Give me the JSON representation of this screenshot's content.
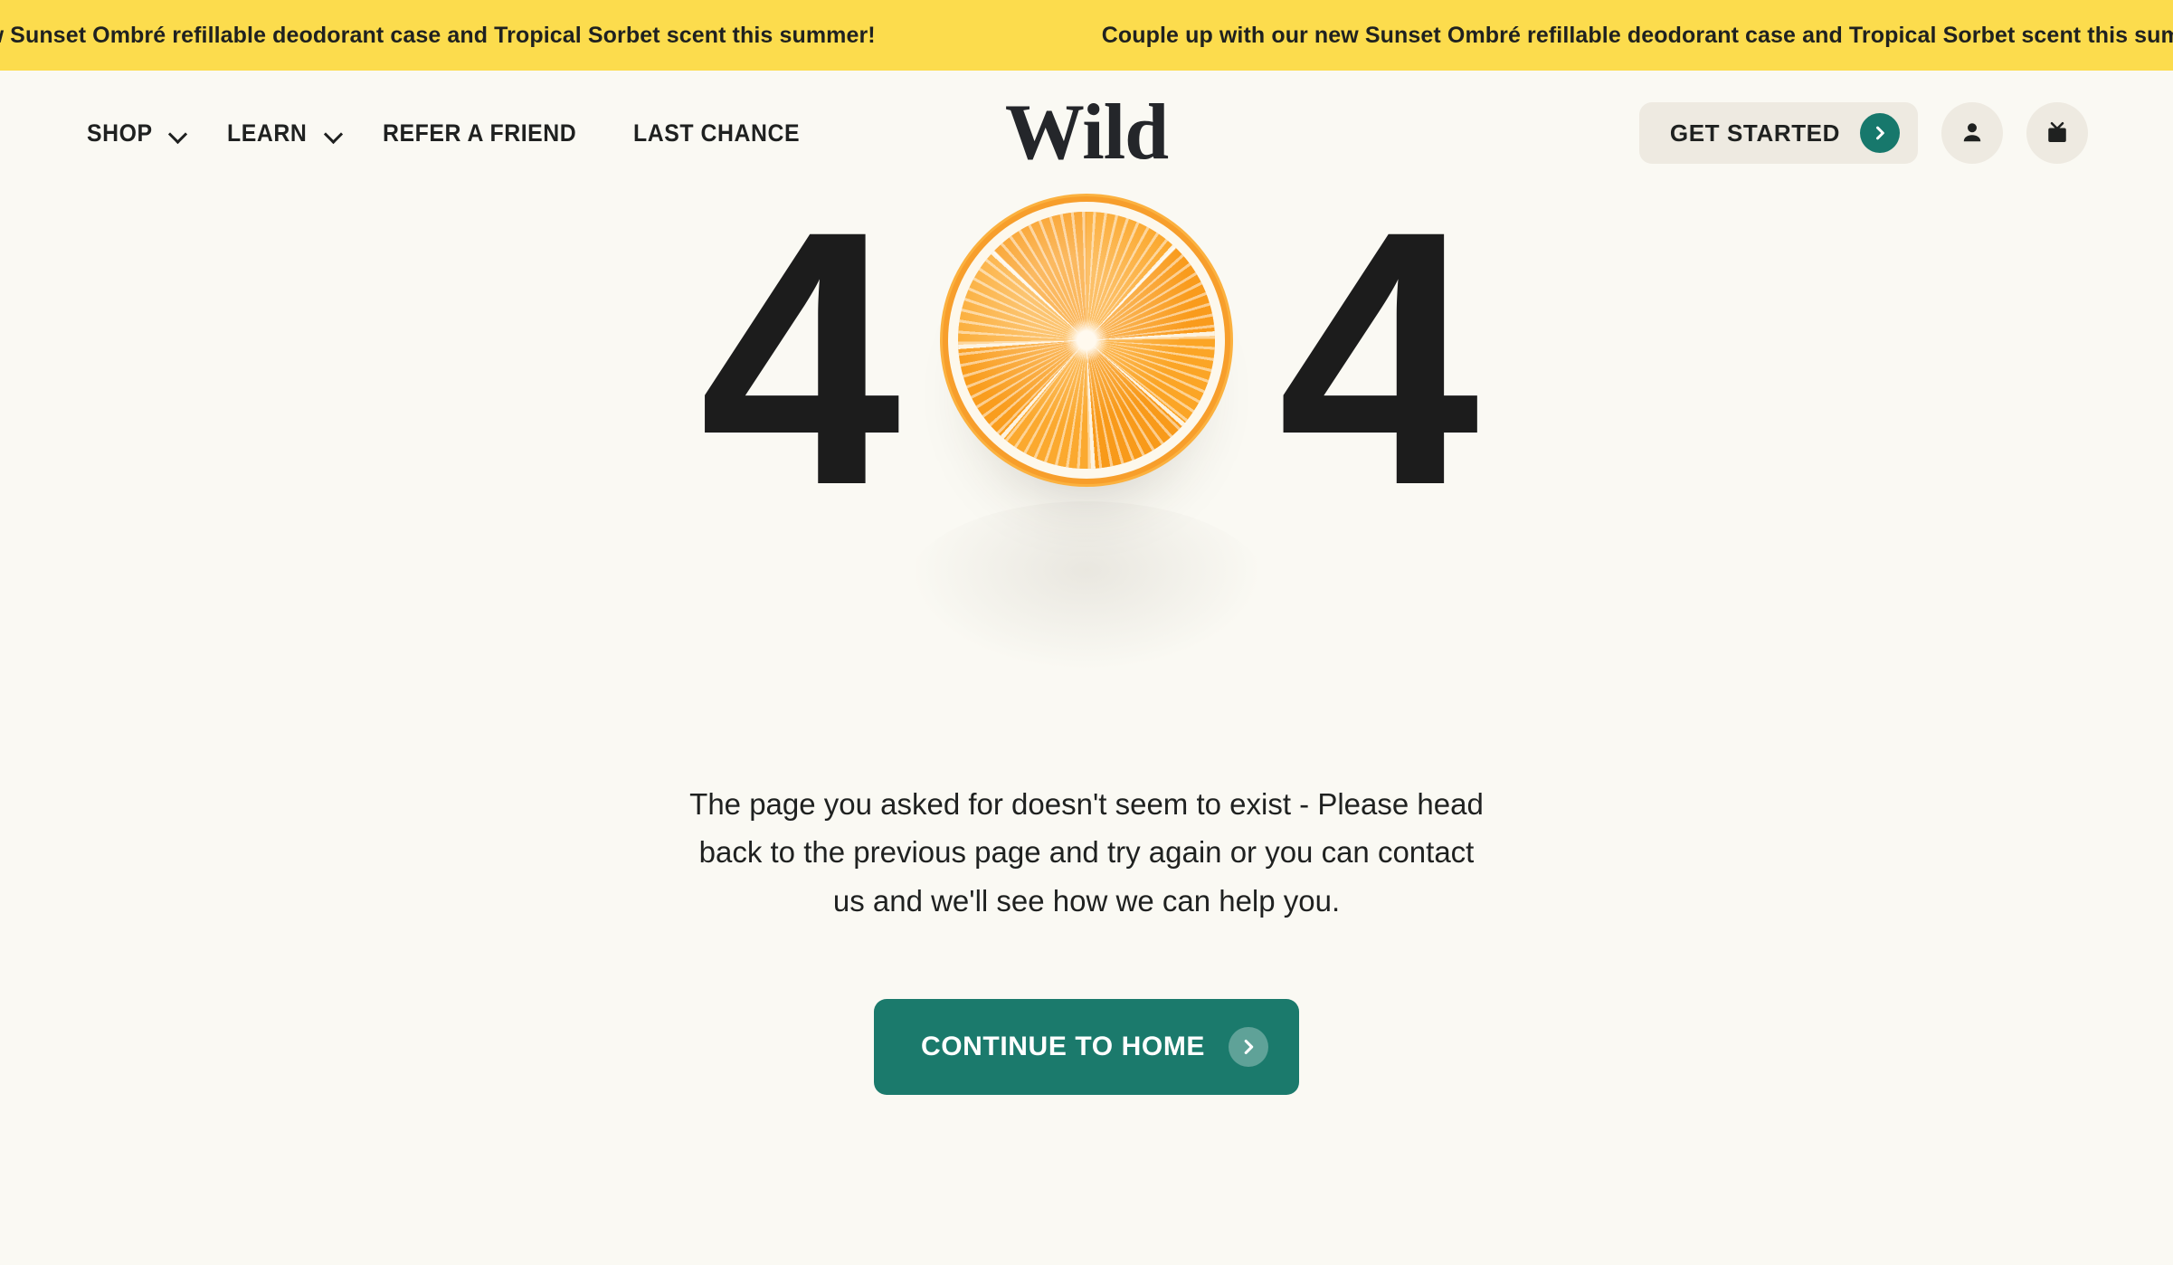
{
  "announcement": {
    "message": "Couple up with our new Sunset Ombré refillable deodorant case and Tropical Sorbet scent this summer!",
    "partial_left": "pical Sorbet scent this summer!",
    "partial_right": "C",
    "background_color": "#fcdc4d",
    "text_color": "#1f2120"
  },
  "header": {
    "logo_text": "Wild",
    "nav": [
      {
        "label": "SHOP",
        "has_dropdown": true,
        "icon": "chevron-down-icon"
      },
      {
        "label": "LEARN",
        "has_dropdown": true,
        "icon": "chevron-down-icon"
      },
      {
        "label": "REFER A FRIEND",
        "has_dropdown": false
      },
      {
        "label": "LAST CHANCE",
        "has_dropdown": false
      }
    ],
    "get_started_label": "GET STARTED",
    "get_started_icon": "chevron-right-icon",
    "account_icon": "user-icon",
    "basket_icon": "basket-icon",
    "accent_color": "#17786c",
    "button_background": "#eeeae1"
  },
  "main": {
    "error_code": "404",
    "digit_left": "4",
    "digit_right": "4",
    "zero_graphic": "orange-slice-image",
    "message": "The page you asked for doesn't seem to exist - Please head back to the previous page and try again or you can contact us and we'll see how we can help you.",
    "cta_label": "CONTINUE TO HOME",
    "cta_icon": "chevron-right-icon",
    "cta_color": "#1b7a6c"
  },
  "page": {
    "background_color": "#faf9f3",
    "text_color": "#1f2120"
  }
}
